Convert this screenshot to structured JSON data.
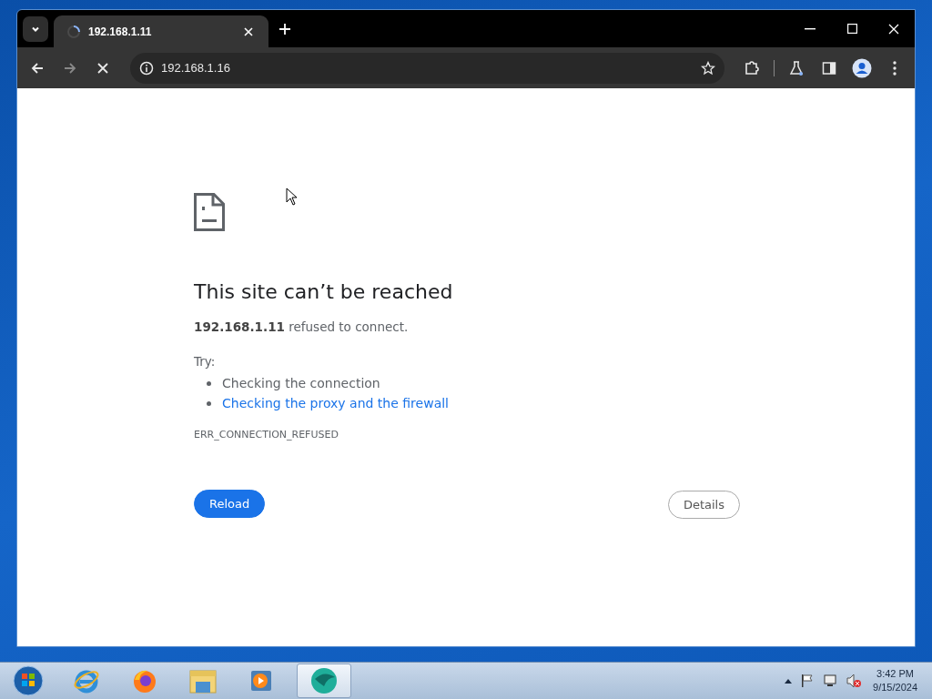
{
  "tabs": [
    {
      "title": "192.168.1.11",
      "selected": true,
      "loading": true
    }
  ],
  "address_bar": {
    "url": "192.168.1.16"
  },
  "page": {
    "heading": "This site can’t be reached",
    "message": "**192.168.1.11** refused to connect.",
    "try_label": "Try:",
    "suggestions": [
      {
        "kind": "text",
        "text": "Checking the connection"
      },
      {
        "kind": "link",
        "text": "Checking the proxy and the firewall"
      }
    ],
    "error_code": "ERR_CONNECTION_REFUSED",
    "buttons": [
      {
        "label": "Reload",
        "kind": "primary"
      },
      {
        "label": "Details",
        "kind": "outline"
      }
    ]
  },
  "taskbar": {
    "items": [
      {
        "kind": "ie",
        "selected": false
      },
      {
        "kind": "firefox",
        "selected": false
      },
      {
        "kind": "explorer",
        "selected": false
      },
      {
        "kind": "media",
        "selected": false
      },
      {
        "kind": "app",
        "selected": true
      }
    ],
    "clock": {
      "time": "3:42 PM",
      "date": "9/15/2024"
    }
  }
}
